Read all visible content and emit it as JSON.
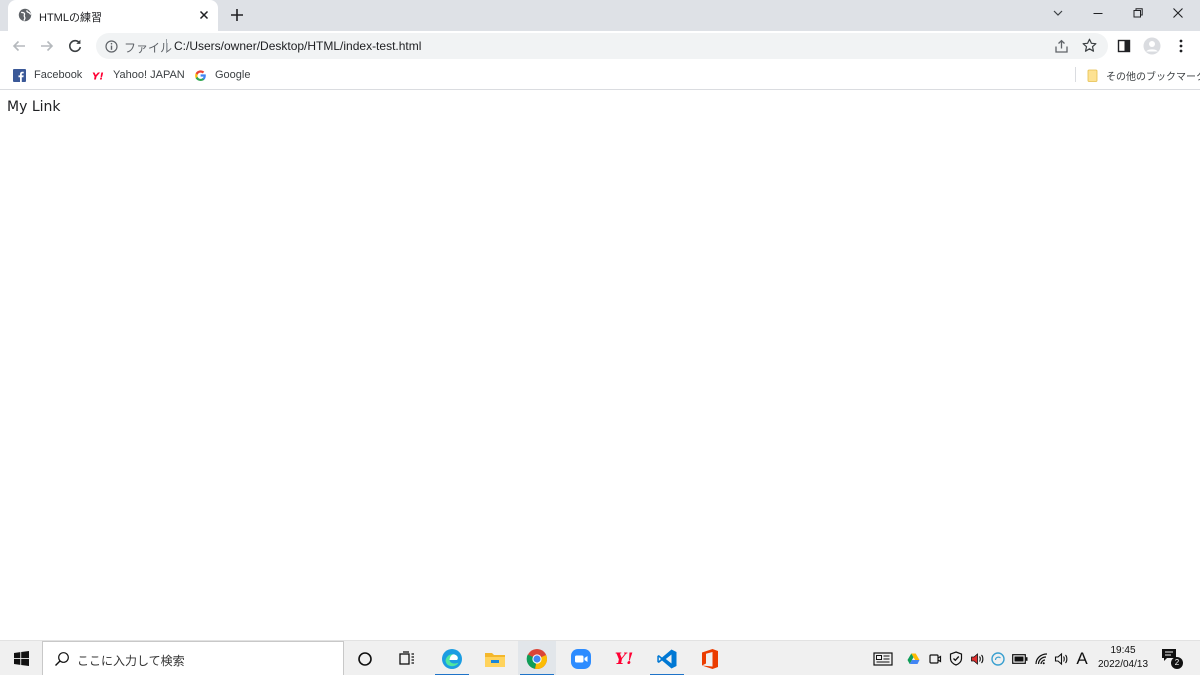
{
  "browser": {
    "tab": {
      "title": "HTMLの練習"
    },
    "address_bar": {
      "scheme_label": "ファイル",
      "url": "C:/Users/owner/Desktop/HTML/index-test.html"
    },
    "bookmarks": [
      {
        "label": "Facebook",
        "icon": "facebook-icon"
      },
      {
        "label": "Yahoo! JAPAN",
        "icon": "yahoo-icon"
      },
      {
        "label": "Google",
        "icon": "google-icon"
      }
    ],
    "other_bookmarks_label": "その他のブックマーク"
  },
  "page": {
    "link_text": "My Link"
  },
  "taskbar": {
    "search_placeholder": "ここに入力して検索",
    "yahoo_label": "Y!",
    "ime_label": "A",
    "clock": {
      "time": "19:45",
      "date": "2022/04/13"
    },
    "notification_count": "2"
  },
  "colors": {
    "tab_strip": "#dee1e6",
    "omnibox": "#f1f3f4",
    "taskbar": "#f0f0f0",
    "accent_blue": "#1e73c8"
  }
}
